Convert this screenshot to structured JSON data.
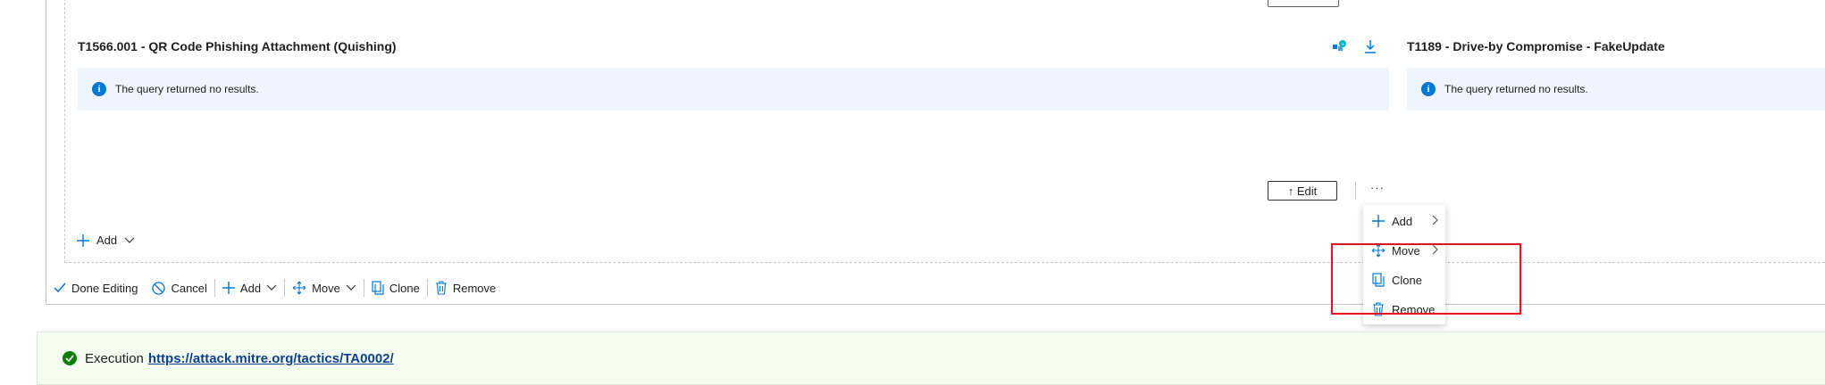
{
  "tiles": [
    {
      "title": "T1566.001 - QR Code Phishing Attachment (Quishing)",
      "message": "The query returned no results."
    },
    {
      "title": "T1189 - Drive-by Compromise - FakeUpdate",
      "message": "The query returned no results."
    }
  ],
  "tile_actions": {
    "edit_label": "↑ Edit",
    "more_label": "···"
  },
  "add_menu": {
    "label": "Add"
  },
  "context_menu": {
    "items": [
      {
        "label": "Add"
      },
      {
        "label": "Move"
      },
      {
        "label": "Clone"
      },
      {
        "label": "Remove"
      }
    ]
  },
  "toolbar": {
    "done_editing": "Done Editing",
    "cancel": "Cancel",
    "add": "Add",
    "move": "Move",
    "clone": "Clone",
    "remove": "Remove"
  },
  "execution": {
    "label": "Execution",
    "link": "https://attack.mitre.org/tactics/TA0002/"
  },
  "colors": {
    "accent": "#0078d4",
    "highlight": "#e81123",
    "success": "#107c10",
    "info_bg": "#eef5fc",
    "exec_bg": "#f3fdf0"
  }
}
